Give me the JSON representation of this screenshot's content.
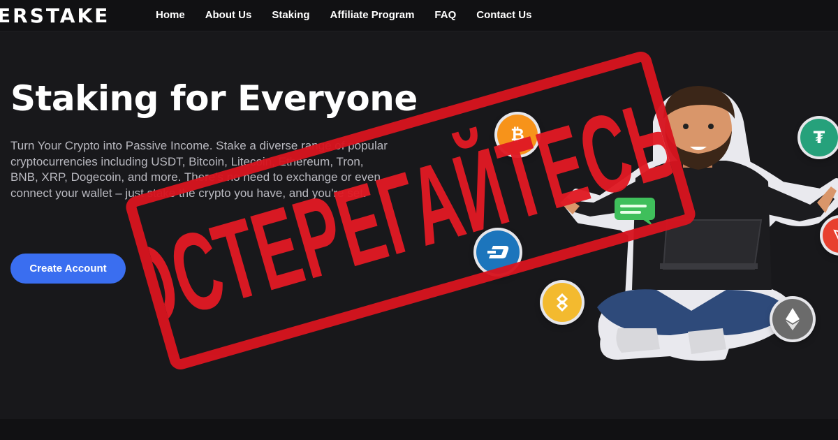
{
  "brand": {
    "logo_text": "ERSTAKE"
  },
  "nav": {
    "items": [
      {
        "label": "Home"
      },
      {
        "label": "About Us"
      },
      {
        "label": "Staking"
      },
      {
        "label": "Affiliate Program"
      },
      {
        "label": "FAQ"
      },
      {
        "label": "Contact Us"
      }
    ]
  },
  "hero": {
    "title": "Staking for Everyone",
    "description": "Turn Your Crypto into Passive Income. Stake a diverse range of popular cryptocurrencies including USDT, Bitcoin, Litecoin, Ethereum, Tron, BNB, XRP, Dogecoin, and more. There's no need to exchange or even connect your wallet – just stake the crypto you have, and you're set.",
    "cta_label": "Create Account"
  },
  "overlay": {
    "stamp_text": "ОСТЕРЕГАЙТЕСЬ!",
    "stamp_color": "#e01a24"
  },
  "coins": [
    {
      "name": "bitcoin",
      "icon": "bitcoin-icon",
      "color": "#f7931a"
    },
    {
      "name": "tether",
      "icon": "tether-icon",
      "color": "#26a17b"
    },
    {
      "name": "dash",
      "icon": "dash-icon",
      "color": "#1c75bc"
    },
    {
      "name": "bnb",
      "icon": "bnb-icon",
      "color": "#f3ba2f"
    },
    {
      "name": "ethereum",
      "icon": "ethereum-icon",
      "color": "#6b6b6b"
    },
    {
      "name": "tron",
      "icon": "tron-icon",
      "color": "#e8402f"
    }
  ],
  "colors": {
    "background": "#18181b",
    "accent": "#3a6ef0",
    "stamp": "#d7141f"
  }
}
